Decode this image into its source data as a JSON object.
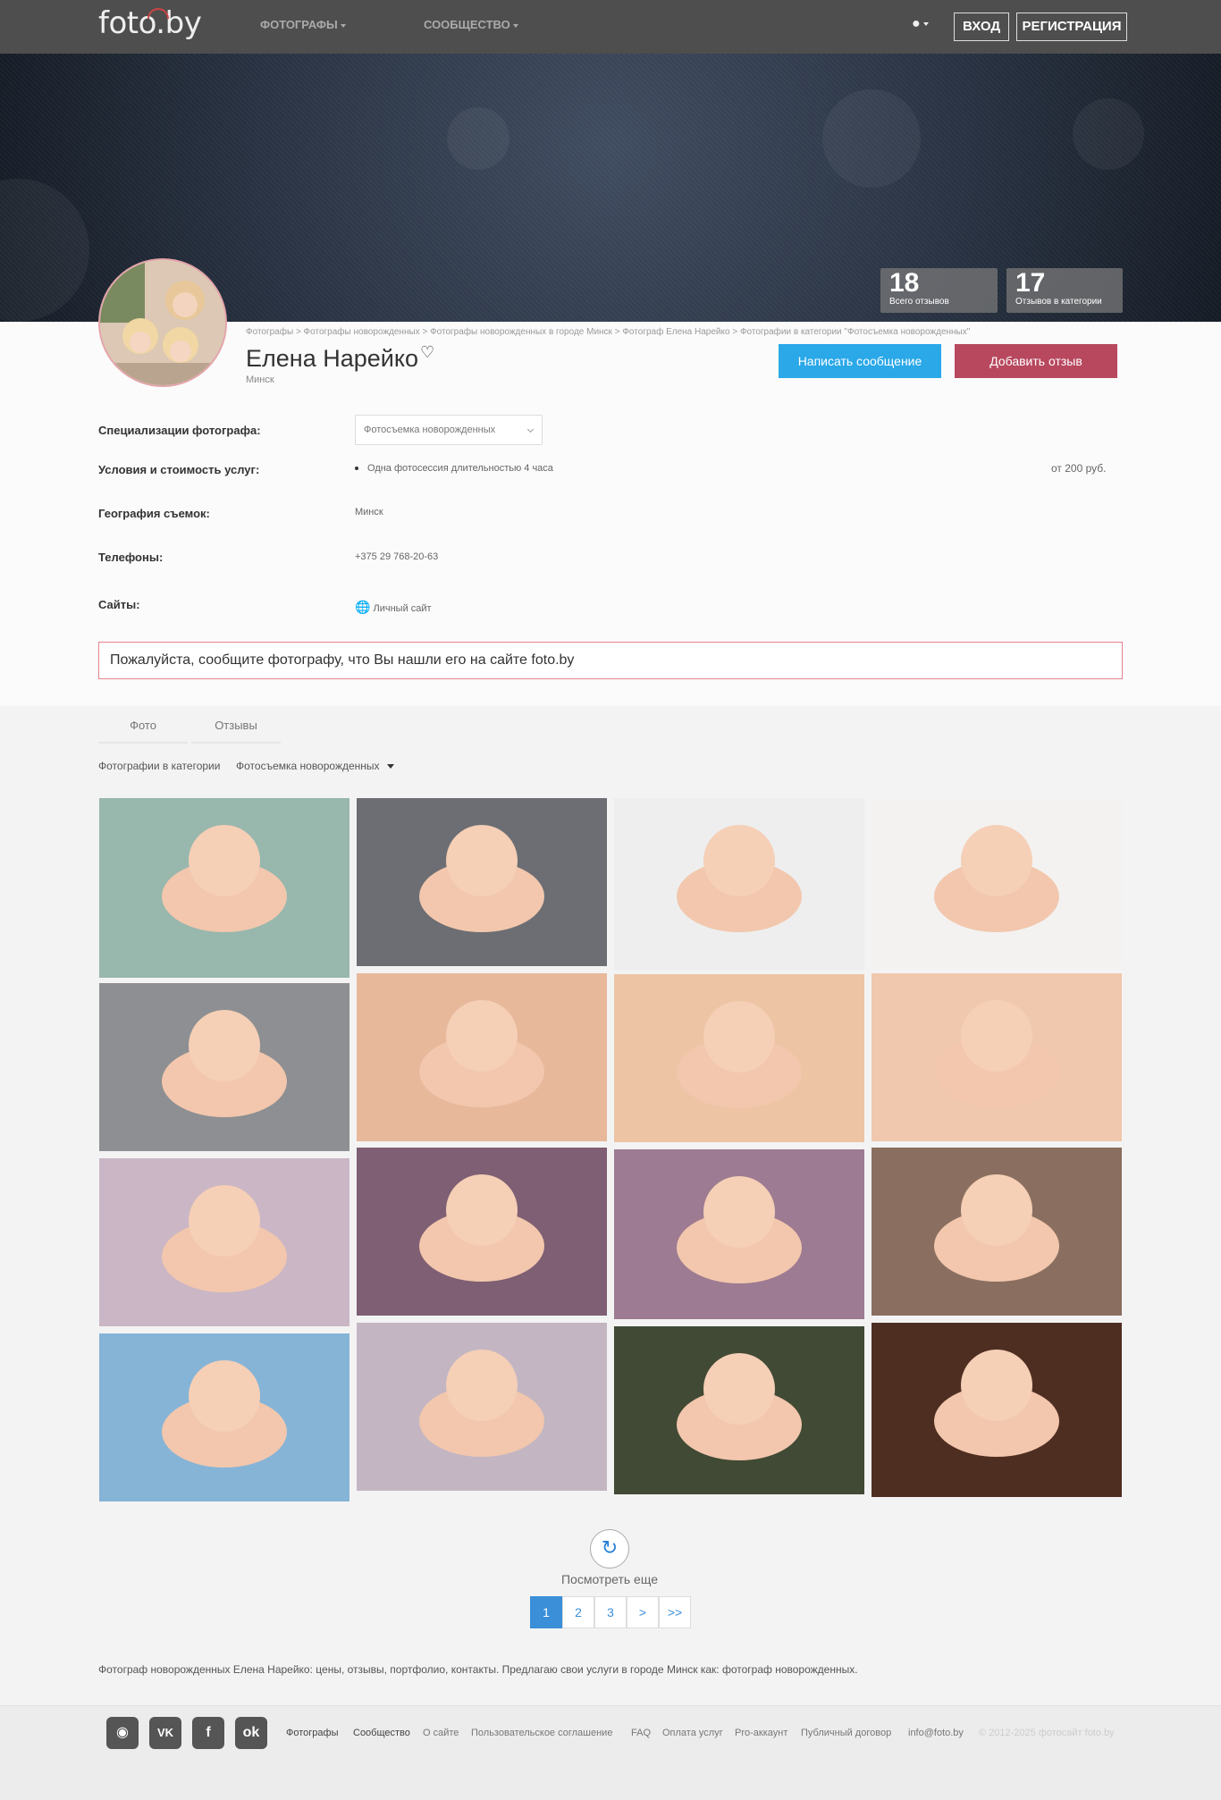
{
  "nav": {
    "logo": "foto.by",
    "photographers": "ФОТОГРАФЫ",
    "community": "СООБЩЕСТВО",
    "login": "ВХОД",
    "register": "РЕГИСТРАЦИЯ"
  },
  "stats": [
    {
      "num": "18",
      "label": "Всего отзывов"
    },
    {
      "num": "17",
      "label": "Отзывов в категории"
    }
  ],
  "breadcrumb": "Фотографы > Фотографы новорожденных > Фотографы новорожденных в городе Минск > Фотограф Елена Нарейко > Фотографии в категории \"Фотосъемка новорожденных\"",
  "profile": {
    "name": "Елена Нарейко",
    "city": "Минск",
    "msg_button": "Написать сообщение",
    "review_button": "Добавить отзыв"
  },
  "details": {
    "spec_label": "Специализации фотографа:",
    "spec_value": "Фотосъемка новорожденных",
    "terms_label": "Условия и стоимость услуг:",
    "terms_value": "Одна фотосессия длительностью 4 часа",
    "terms_price": "от 200 руб.",
    "geo_label": "География съемок:",
    "geo_value": "Минск",
    "phones_label": "Телефоны:",
    "phones_value": "+375 29 768-20-63",
    "sites_label": "Сайты:",
    "sites_value": "Личный сайт"
  },
  "notice": "Пожалуйста, сообщите фотографу, что Вы нашли его на сайте foto.by",
  "tabs": {
    "photo": "Фото",
    "reviews": "Отзывы"
  },
  "filter": {
    "label": "Фотографии в категории",
    "value": "Фотосъемка новорожденных"
  },
  "gallery": [
    {
      "name": "photo-1",
      "bg": "#98b7ad"
    },
    {
      "name": "photo-2",
      "bg": "#6c6e73"
    },
    {
      "name": "photo-3",
      "bg": "#eeeeee"
    },
    {
      "name": "photo-4",
      "bg": "#f3f2f1"
    },
    {
      "name": "photo-5",
      "bg": "#8d8f92"
    },
    {
      "name": "photo-6",
      "bg": "#e8b89b"
    },
    {
      "name": "photo-7",
      "bg": "#edc4a4"
    },
    {
      "name": "photo-8",
      "bg": "#f0c8ad"
    },
    {
      "name": "photo-9",
      "bg": "#cbb6c5"
    },
    {
      "name": "photo-10",
      "bg": "#7e5f73"
    },
    {
      "name": "photo-11",
      "bg": "#9d7b92"
    },
    {
      "name": "photo-12",
      "bg": "#8a6f60"
    },
    {
      "name": "photo-13",
      "bg": "#86b4d7"
    },
    {
      "name": "photo-14",
      "bg": "#c3b6c2"
    },
    {
      "name": "photo-15",
      "bg": "#414a34"
    },
    {
      "name": "photo-16",
      "bg": "#4f2e22"
    }
  ],
  "pager": {
    "more": "Посмотреть еще",
    "p1": "1",
    "p2": "2",
    "p3": "3",
    "next": ">",
    "last": ">>"
  },
  "seo": "Фотограф новорожденных Елена Нарейко: цены, отзывы, портфолио, контакты. Предлагаю свои услуги в городе Минск как: фотограф новорожденных.",
  "footer": {
    "photographers": "Фотографы",
    "community": "Сообщество",
    "about": "О сайте",
    "agreement": "Пользовательское соглашение",
    "faq": "FAQ",
    "payment": "Оплата услуг",
    "pro": "Pro-аккаунт",
    "contract": "Публичный договор",
    "email": "info@foto.by",
    "copyright": "© 2012-2025 фотосайт foto.by"
  }
}
